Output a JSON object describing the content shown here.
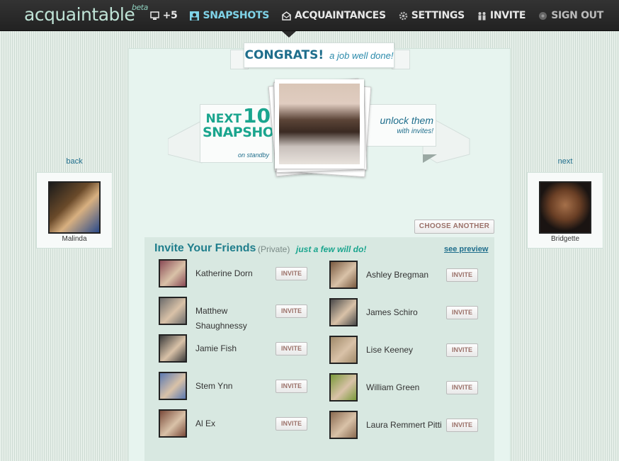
{
  "app": {
    "logo": "acquaintable",
    "beta": "beta"
  },
  "nav": {
    "items": [
      {
        "label": "+5",
        "icon": "monitor-icon"
      },
      {
        "label": "Snapshots",
        "icon": "portrait-icon",
        "active": true
      },
      {
        "label": "Acquaintances",
        "icon": "envelope-icon"
      },
      {
        "label": "Settings",
        "icon": "gear-icon"
      },
      {
        "label": "Invite",
        "icon": "people-icon"
      },
      {
        "label": "Sign Out",
        "icon": "power-icon"
      }
    ]
  },
  "banner": {
    "congrats": "CONGRATS!",
    "well_done": "a job well done!",
    "next": "NEXT",
    "ten": "10",
    "snapshots": "SNAPSHOTS",
    "standby": "on standby",
    "unlock": "unlock them",
    "with_invites": "with invites!"
  },
  "navigation": {
    "back_label": "back",
    "back_name": "Malinda",
    "next_label": "next",
    "next_name": "Bridgette"
  },
  "choose_another": "CHOOSE ANOTHER",
  "invite": {
    "title": "Invite Your Friends",
    "private": "(Private)",
    "few": "just a few will do!",
    "see_preview": "see preview",
    "button_label": "INVITE",
    "left": [
      {
        "name": "Katherine Dorn",
        "color": "#8a4a55"
      },
      {
        "name": "Matthew Shaughnessy",
        "color": "#6b6b6b"
      },
      {
        "name": "Jamie Fish",
        "color": "#3a3a3a"
      },
      {
        "name": "Stem Ynn",
        "color": "#5a78b0"
      },
      {
        "name": "Al Ex",
        "color": "#7a4a3a"
      }
    ],
    "right": [
      {
        "name": "Ashley Bregman",
        "color": "#7a5a40"
      },
      {
        "name": "James Schiro",
        "color": "#4a4a4a"
      },
      {
        "name": "Lise Keeney",
        "color": "#a08a6a"
      },
      {
        "name": "William Green",
        "color": "#7a9a3a"
      },
      {
        "name": "Laura Remmert Pitti",
        "color": "#8a6a50"
      }
    ]
  }
}
